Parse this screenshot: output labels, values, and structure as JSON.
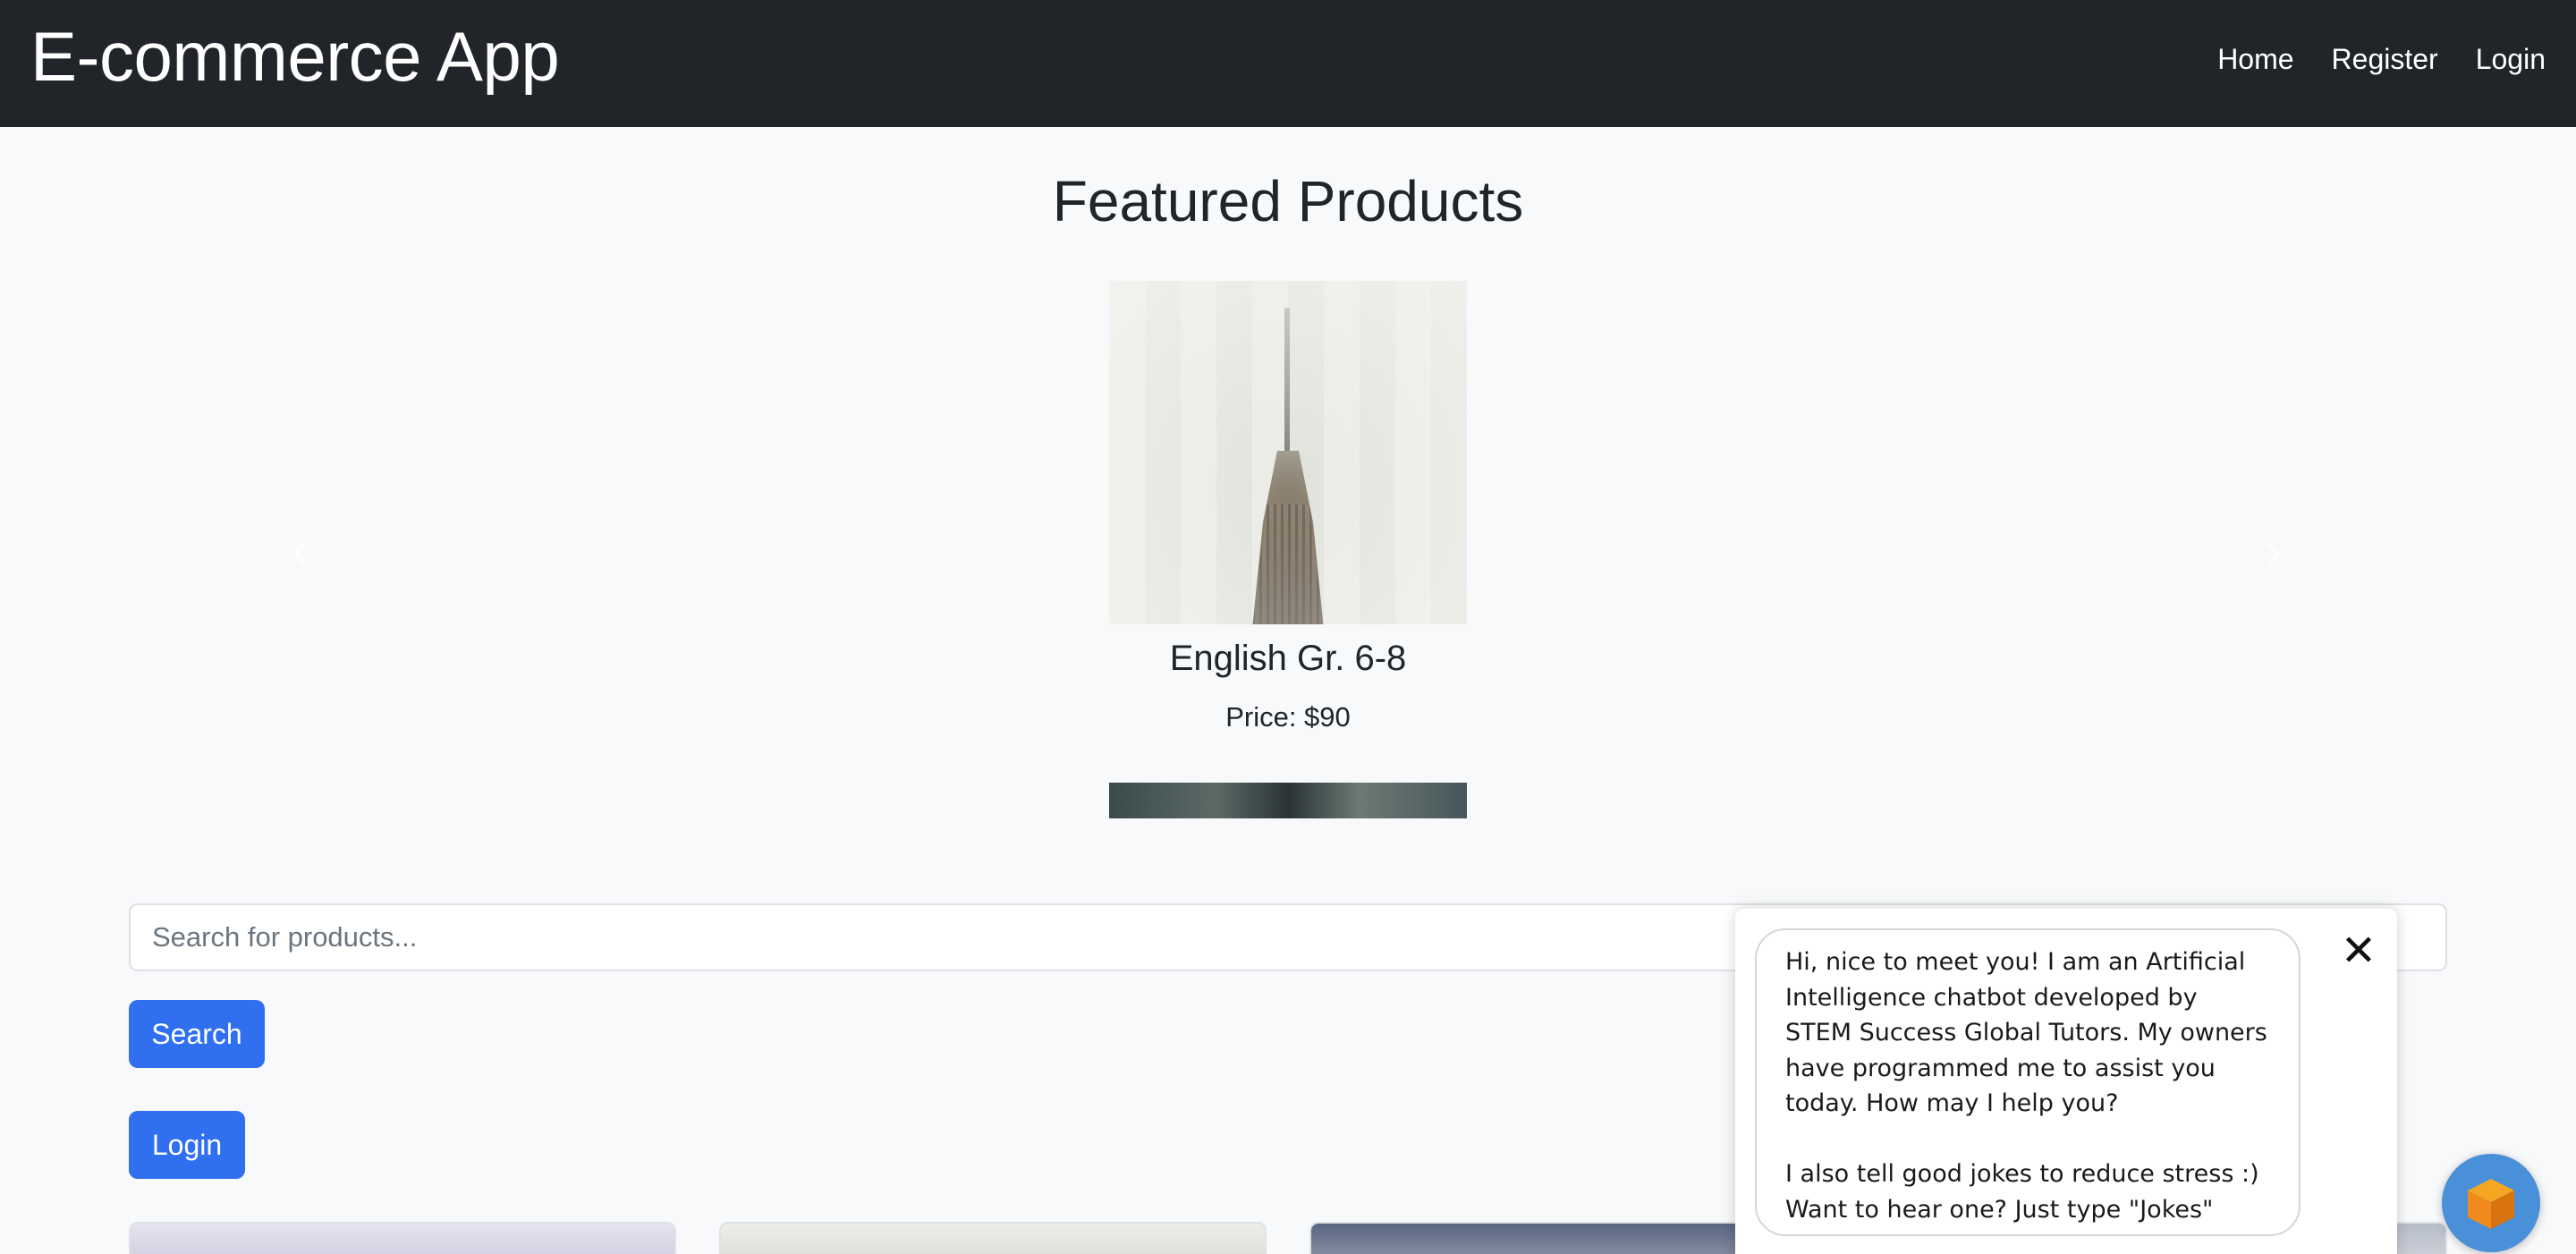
{
  "navbar": {
    "brand": "E-commerce App",
    "links": [
      {
        "label": "Home"
      },
      {
        "label": "Register"
      },
      {
        "label": "Login"
      }
    ]
  },
  "featured": {
    "title": "Featured Products",
    "prev_icon": "‹",
    "next_icon": "›",
    "current_item": {
      "name": "English Gr. 6-8",
      "price": "Price: $90"
    }
  },
  "search": {
    "placeholder": "Search for products...",
    "value": "",
    "button_label": "Search"
  },
  "login_button_label": "Login",
  "chat": {
    "close_icon": "✕",
    "message_line1": "Hi, nice to meet you! I am an Artificial Intelligence chatbot developed by STEM Success Global Tutors. My owners have programmed me to assist you today. How may I help you?",
    "message_line2": "I also tell good jokes to reduce stress :) Want to hear one? Just type \"Jokes\"",
    "launcher_icon": "cube-icon",
    "launcher_color": "#4a90d9"
  },
  "colors": {
    "navbar_bg": "#212529",
    "page_bg": "#f8f9fa",
    "primary_button": "#2f6ff0"
  }
}
